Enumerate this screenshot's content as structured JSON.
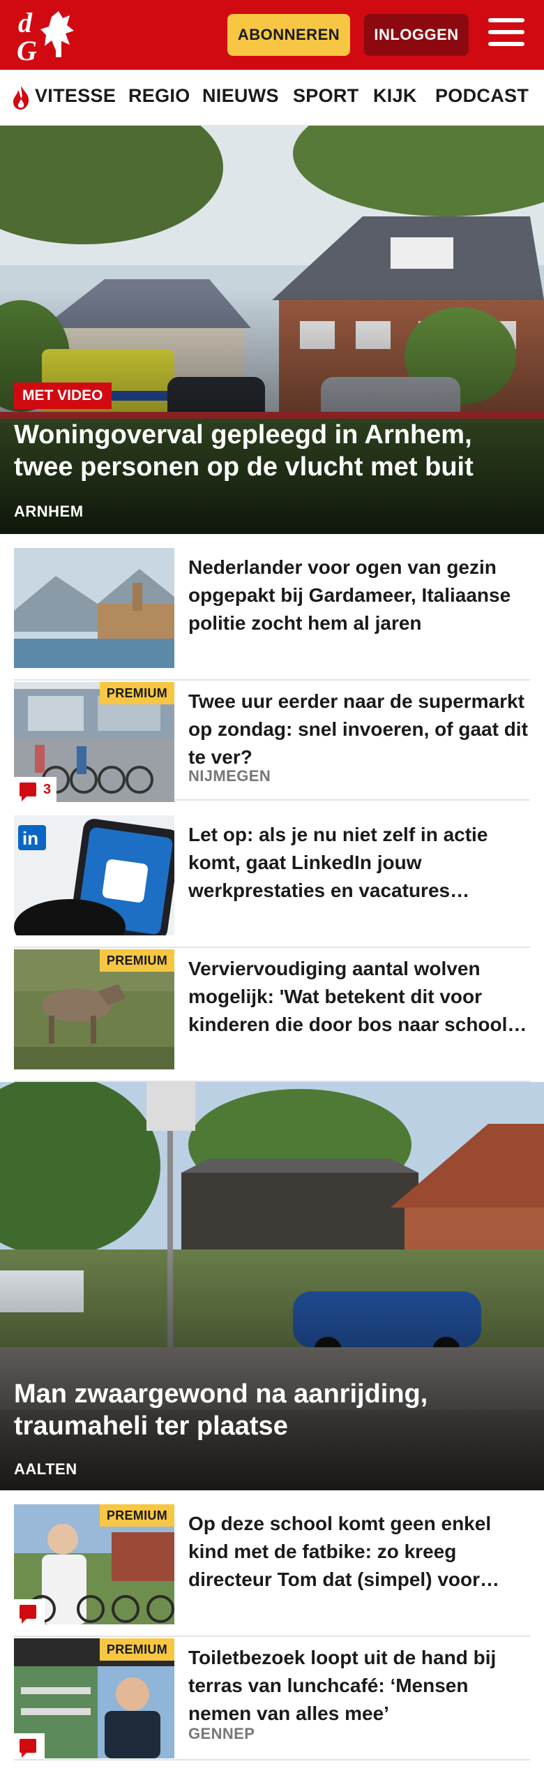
{
  "header": {
    "logo_text": "dG",
    "subscribe_label": "ABONNEREN",
    "login_label": "INLOGGEN",
    "brand_color": "#d10a11",
    "accent_color": "#f7c744"
  },
  "nav": {
    "items": [
      "VITESSE",
      "REGIO",
      "NIEUWS",
      "SPORT",
      "KIJK",
      "PODCAST"
    ],
    "icon": "flame-icon"
  },
  "hero1": {
    "badge": "MET VIDEO",
    "title": "Woningoverval gepleegd in Arnhem, twee personen op de vlucht met buit",
    "location": "ARNHEM"
  },
  "articles1": [
    {
      "title": "Nederlander voor ogen van gezin opgepakt bij Gardameer, Italiaanse politie zocht hem al jaren",
      "premium": "",
      "location": "",
      "comments": ""
    },
    {
      "title": "Twee uur eerder naar de supermarkt op zondag: snel invoeren, of gaat dit te ver?",
      "premium": "PREMIUM",
      "location": "NIJMEGEN",
      "comments": "3"
    },
    {
      "title": "Let op: als je nu niet zelf in actie komt, gaat LinkedIn jouw werkprestaties en vacatures gebruiken",
      "premium": "",
      "location": "",
      "comments": ""
    },
    {
      "title": "Verviervoudiging aantal wolven mogelijk: 'Wat betekent dit voor kinderen die door bos naar school gaan?'",
      "premium": "PREMIUM",
      "location": "",
      "comments": ""
    }
  ],
  "hero2": {
    "title": "Man zwaargewond na aanrijding, traumaheli ter plaatse",
    "location": "AALTEN"
  },
  "articles2": [
    {
      "title": "Op deze school komt geen enkel kind met de fatbike: zo kreeg directeur Tom dat (simpel) voor elkaar",
      "premium": "PREMIUM",
      "location": "",
      "comments": ""
    },
    {
      "title": "Toiletbezoek loopt uit de hand bij terras van lunchcafé: ‘Mensen nemen van alles mee’",
      "premium": "PREMIUM",
      "location": "GENNEP",
      "comments": ""
    }
  ]
}
